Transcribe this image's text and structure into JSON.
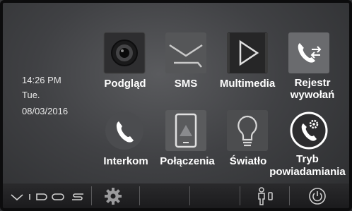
{
  "status": {
    "time": "14:26  PM",
    "day": "Tue.",
    "date": "08/03/2016"
  },
  "apps": [
    {
      "id": "podglad",
      "label": "Podgląd",
      "icon": "camera-icon"
    },
    {
      "id": "sms",
      "label": "SMS",
      "icon": "envelope-icon"
    },
    {
      "id": "multimedia",
      "label": "Multimedia",
      "icon": "play-icon"
    },
    {
      "id": "rejestr",
      "label_line1": "Rejestr",
      "label_line2": "wywołań",
      "icon": "call-log-icon"
    },
    {
      "id": "interkom",
      "label": "Interkom",
      "icon": "phone-handset-icon"
    },
    {
      "id": "polaczenia",
      "label": "Połączenia",
      "icon": "tablet-icon"
    },
    {
      "id": "swiatlo",
      "label": "Światło",
      "icon": "lightbulb-icon"
    },
    {
      "id": "tryb",
      "label_line1": "Tryb",
      "label_line2": "powiadamiania",
      "icon": "call-settings-icon"
    }
  ],
  "bottom_bar": {
    "logo": "VIDOS",
    "icons": [
      "gear-icon",
      "person-door-icon",
      "power-icon"
    ]
  },
  "colors": {
    "label": "#ffffff",
    "background": "#3f4043",
    "bar": "#1e1e20"
  }
}
